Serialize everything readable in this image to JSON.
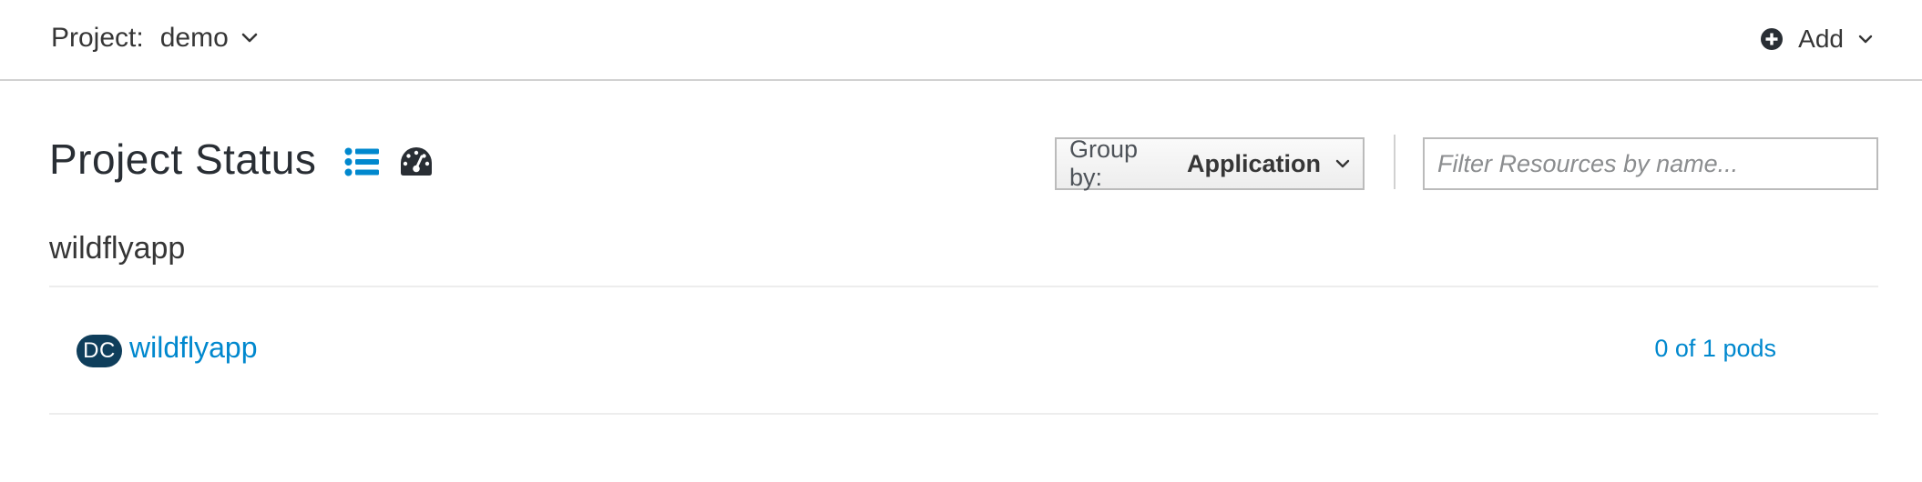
{
  "topbar": {
    "project_label": "Project:",
    "project_name": "demo",
    "add_label": "Add"
  },
  "status": {
    "title": "Project Status",
    "group_by_label": "Group by:",
    "group_by_value": "Application",
    "filter_placeholder": "Filter Resources by name..."
  },
  "application": {
    "name": "wildflyapp",
    "items": [
      {
        "kind_badge": "DC",
        "name": "wildflyapp",
        "pods": "0 of 1 pods"
      }
    ]
  },
  "colors": {
    "link": "#0088ce",
    "badge_bg": "#0f3e5b",
    "list_icon_active": "#0088ce",
    "dashboard_icon": "#292e34"
  },
  "icons": {
    "project_chevron": "chevron-down-icon",
    "add": "plus-circle-icon",
    "list_view": "list-view-icon",
    "dashboard_view": "dashboard-icon",
    "group_chevron": "chevron-down-icon"
  }
}
